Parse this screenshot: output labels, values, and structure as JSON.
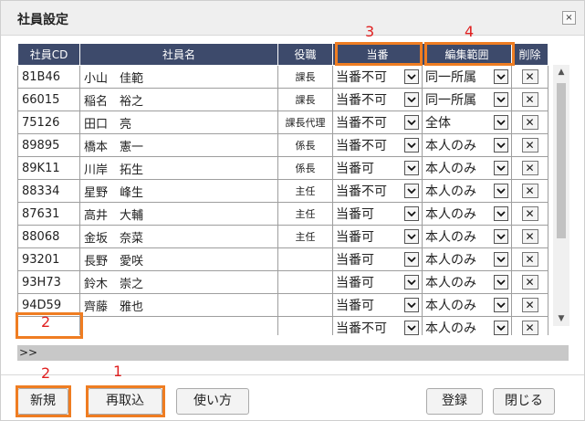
{
  "dialog": {
    "title": "社員設定",
    "close_label": "×"
  },
  "columns": [
    "社員CD",
    "社員名",
    "役職",
    "当番",
    "編集範囲",
    "削除"
  ],
  "rows": [
    {
      "cd": "81B46",
      "name": "小山　佳範",
      "role": "課長",
      "duty": "当番不可",
      "scope": "同一所属",
      "delete": "✕"
    },
    {
      "cd": "66015",
      "name": "稲名　裕之",
      "role": "課長",
      "duty": "当番不可",
      "scope": "同一所属",
      "delete": "✕"
    },
    {
      "cd": "75126",
      "name": "田口　亮",
      "role": "課長代理",
      "duty": "当番不可",
      "scope": "全体",
      "delete": "✕"
    },
    {
      "cd": "89895",
      "name": "橋本　憲一",
      "role": "係長",
      "duty": "当番不可",
      "scope": "本人のみ",
      "delete": "✕"
    },
    {
      "cd": "89K11",
      "name": "川岸　拓生",
      "role": "係長",
      "duty": "当番可",
      "scope": "本人のみ",
      "delete": "✕"
    },
    {
      "cd": "88334",
      "name": "星野　峰生",
      "role": "主任",
      "duty": "当番不可",
      "scope": "本人のみ",
      "delete": "✕"
    },
    {
      "cd": "87631",
      "name": "高井　大輔",
      "role": "主任",
      "duty": "当番可",
      "scope": "本人のみ",
      "delete": "✕"
    },
    {
      "cd": "88068",
      "name": "金坂　奈菜",
      "role": "主任",
      "duty": "当番可",
      "scope": "本人のみ",
      "delete": "✕"
    },
    {
      "cd": "93201",
      "name": "長野　愛咲",
      "role": "",
      "duty": "当番可",
      "scope": "本人のみ",
      "delete": "✕"
    },
    {
      "cd": "93H73",
      "name": "鈴木　崇之",
      "role": "",
      "duty": "当番可",
      "scope": "本人のみ",
      "delete": "✕"
    },
    {
      "cd": "94D59",
      "name": "齊藤　雅也",
      "role": "",
      "duty": "当番可",
      "scope": "本人のみ",
      "delete": "✕"
    },
    {
      "cd": "",
      "name": "",
      "role": "",
      "duty": "当番不可",
      "scope": "本人のみ",
      "delete": "✕"
    }
  ],
  "pager": {
    "label": ">>"
  },
  "buttons": {
    "new": "新規",
    "reload": "再取込",
    "howto": "使い方",
    "register": "登録",
    "close": "閉じる"
  },
  "annotations": {
    "duty_marker": "3",
    "scope_marker": "4",
    "new_row_marker": "2",
    "new_button_marker": "2",
    "reload_button_marker": "1"
  },
  "colors": {
    "header_bg": "#3d4a6b",
    "highlight": "#ef7d22",
    "annotation": "#e02020"
  }
}
